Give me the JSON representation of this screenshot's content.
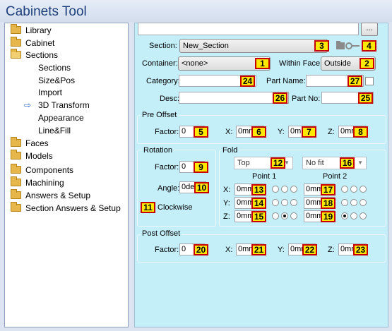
{
  "window_title": "Cabinets Tool",
  "tree": {
    "items": [
      {
        "label": "Library",
        "icon": "folder-icon"
      },
      {
        "label": "Cabinet",
        "icon": "folder-icon"
      },
      {
        "label": "Sections",
        "icon": "folder-open-icon"
      },
      {
        "label": "Sections"
      },
      {
        "label": "Size&Pos"
      },
      {
        "label": "Import"
      },
      {
        "label": "3D Transform",
        "selected_marker": "⇨"
      },
      {
        "label": "Appearance"
      },
      {
        "label": "Line&Fill"
      },
      {
        "label": "Faces",
        "icon": "folder-icon"
      },
      {
        "label": "Models",
        "icon": "folder-icon"
      },
      {
        "label": "Components",
        "icon": "folder-icon"
      },
      {
        "label": "Machining",
        "icon": "folder-icon"
      },
      {
        "label": "Answers & Setup",
        "icon": "folder-icon"
      },
      {
        "label": "Section Answers & Setup",
        "icon": "folder-icon"
      }
    ]
  },
  "panel": {
    "top_input": "",
    "browse_button": "...",
    "section": {
      "label": "Section:",
      "value": "New_Section"
    },
    "container": {
      "label": "Container:",
      "value": "<none>"
    },
    "within_face": {
      "label": "Within Face:",
      "value": "Outside"
    },
    "category": {
      "label": "Category:",
      "value": ""
    },
    "part_name": {
      "label": "Part Name:",
      "value": ""
    },
    "desc": {
      "label": "Desc:",
      "value": ""
    },
    "part_no": {
      "label": "Part No:",
      "value": ""
    },
    "pre_offset": {
      "title": "Pre Offset",
      "factor_label": "Factor:",
      "factor": "0",
      "x_label": "X:",
      "x": "0mm",
      "y_label": "Y:",
      "y": "0mm",
      "z_label": "Z:",
      "z": "0mm"
    },
    "rotation": {
      "title": "Rotation",
      "factor_label": "Factor:",
      "factor": "0",
      "angle_label": "Angle:",
      "angle": "0deg",
      "clockwise_label": "Clockwise"
    },
    "fold": {
      "title": "Fold",
      "dir1": "Top",
      "dir2": "No fit",
      "point1_label": "Point 1",
      "point2_label": "Point 2",
      "x_label": "X:",
      "y_label": "Y:",
      "z_label": "Z:",
      "p1x": "0mm",
      "p1y": "0mm",
      "p1z": "0mm",
      "p2x": "0mm",
      "p2y": "0mm",
      "p2z": "0mm"
    },
    "post_offset": {
      "title": "Post Offset",
      "factor_label": "Factor:",
      "factor": "0",
      "x_label": "X:",
      "x": "0mm",
      "y_label": "Y:",
      "y": "0mm",
      "z_label": "Z:",
      "z": "0mm"
    }
  },
  "badges": [
    "1",
    "2",
    "3",
    "4",
    "5",
    "6",
    "7",
    "8",
    "9",
    "10",
    "11",
    "12",
    "13",
    "14",
    "15",
    "16",
    "17",
    "18",
    "19",
    "20",
    "21",
    "22",
    "23",
    "24",
    "25",
    "26",
    "27"
  ],
  "colors": {
    "panel_bg": "#c4eef8",
    "badge_fill": "#ffe800",
    "badge_border": "#c60000",
    "title_text": "#1e3f7a"
  }
}
